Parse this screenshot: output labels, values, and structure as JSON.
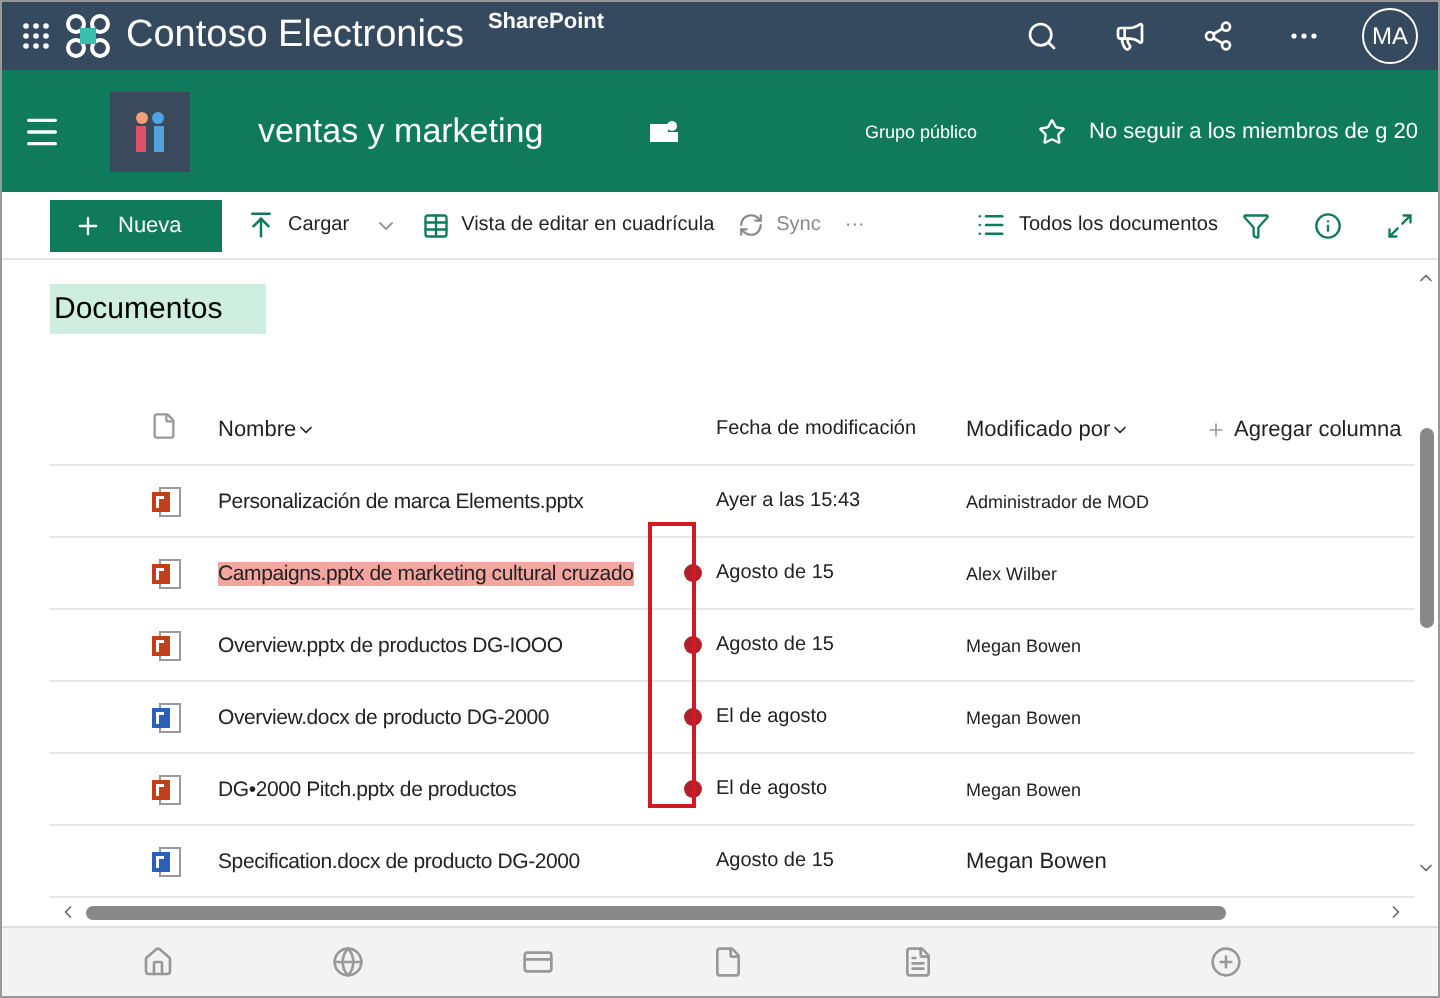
{
  "suite_bar": {
    "brand": "Contoso Electronics",
    "app": "SharePoint",
    "avatar": "MA"
  },
  "site_header": {
    "title": "ventas y marketing",
    "privacy": "Grupo público",
    "follow": "No seguir a los miembros de g 20"
  },
  "command_bar": {
    "new": "Nueva",
    "upload": "Cargar",
    "grid_view": "Vista de editar en cuadrícula",
    "sync": "Sync",
    "more": "···",
    "view": "Todos los documentos"
  },
  "library": {
    "title": "Documentos"
  },
  "table": {
    "columns": [
      "Nombre",
      "Fecha de modificación",
      "Modificado por",
      "Agregar columna"
    ],
    "rows": [
      {
        "kind": "ppt",
        "name": "Personalización de marca Elements.pptx",
        "highlighted": false,
        "flagged": false,
        "modified": "Ayer a las 15:43",
        "modified_by": "Administrador de MOD"
      },
      {
        "kind": "ppt",
        "name": "Campaigns.pptx de marketing cultural cruzado",
        "highlighted": true,
        "flagged": true,
        "modified": "Agosto de 15",
        "modified_by": "Alex Wilber"
      },
      {
        "kind": "ppt",
        "name": "Overview.pptx de productos DG-IOOO",
        "highlighted": false,
        "flagged": true,
        "modified": "Agosto de 15",
        "modified_by": "Megan Bowen"
      },
      {
        "kind": "word",
        "name": "Overview.docx de producto DG-2000",
        "highlighted": false,
        "flagged": true,
        "modified": "El de agosto",
        "modified_by": "Megan Bowen"
      },
      {
        "kind": "ppt",
        "name": "DG•2000 Pitch.pptx de productos",
        "highlighted": false,
        "flagged": true,
        "modified": "El de agosto",
        "modified_by": "Megan Bowen"
      },
      {
        "kind": "word",
        "name": "Specification.docx de producto DG-2000",
        "highlighted": false,
        "flagged": false,
        "modified": "Agosto de 15",
        "modified_by": "Megan Bowen"
      }
    ]
  }
}
